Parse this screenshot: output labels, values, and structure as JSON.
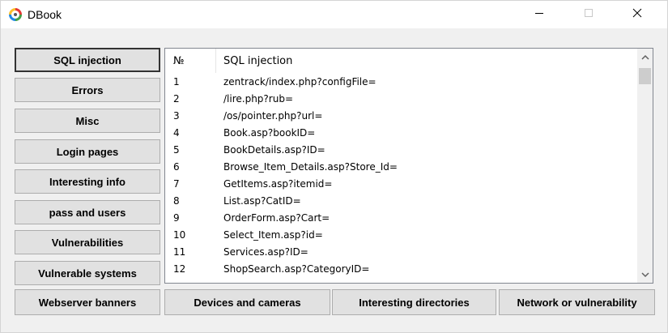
{
  "window": {
    "title": "DBook",
    "icon": "app-logo-icon"
  },
  "title_controls": {
    "minimize_icon": "minimize-icon",
    "maximize_icon": "maximize-icon",
    "close_icon": "close-icon"
  },
  "left_buttons": [
    "SQL injection",
    "Errors",
    "Misc",
    "Login pages",
    "Interesting info",
    "pass and users",
    "Vulnerabilities",
    "Vulnerable systems"
  ],
  "bottom_buttons": [
    "Webserver banners",
    "Devices and cameras",
    "Interesting directories",
    "Network or vulnerability"
  ],
  "list": {
    "columns": [
      "№",
      "SQL injection"
    ],
    "rows": [
      [
        "1",
        "zentrack/index.php?configFile="
      ],
      [
        "2",
        "/lire.php?rub="
      ],
      [
        "3",
        "/os/pointer.php?url="
      ],
      [
        "4",
        "Book.asp?bookID="
      ],
      [
        "5",
        "BookDetails.asp?ID="
      ],
      [
        "6",
        "Browse_Item_Details.asp?Store_Id="
      ],
      [
        "7",
        "GetItems.asp?itemid="
      ],
      [
        "8",
        "List.asp?CatID="
      ],
      [
        "9",
        "OrderForm.asp?Cart="
      ],
      [
        "10",
        "Select_Item.asp?id="
      ],
      [
        "11",
        "Services.asp?ID="
      ],
      [
        "12",
        "ShopSearch.asp?CategoryID="
      ]
    ]
  },
  "colors": {
    "window_bg": "#f0f0f0",
    "button_bg": "#e1e1e1",
    "list_bg": "#ffffff"
  }
}
